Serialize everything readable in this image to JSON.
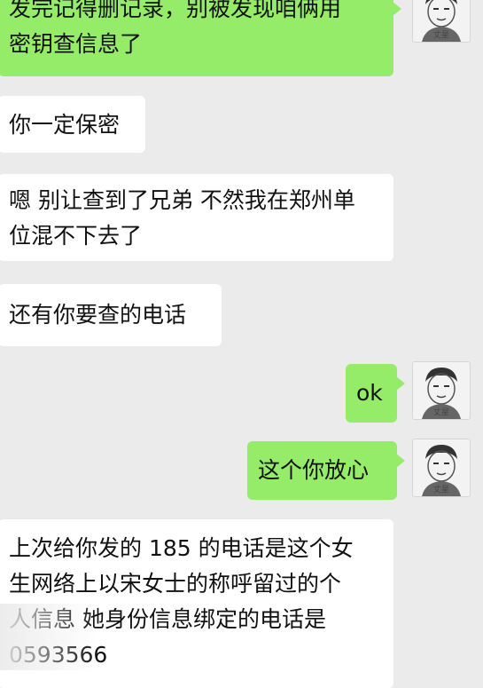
{
  "messages": [
    {
      "side": "out",
      "text": "发完记得删记录，别被发现咱俩用\n密钥查信息了"
    },
    {
      "side": "in",
      "text": "你一定保密"
    },
    {
      "side": "in",
      "text": "嗯 别让查到了兄弟 不然我在郑州单\n位混不下去了"
    },
    {
      "side": "in",
      "text": "还有你要查的电话"
    },
    {
      "side": "out",
      "text": "ok"
    },
    {
      "side": "out",
      "text": "这个你放心"
    },
    {
      "side": "in",
      "text": "上次给你发的 185 的电话是这个女\n生网络上以宋女士的称呼留过的个\n人信息 她身份信息绑定的电话是\n0593566"
    }
  ],
  "avatar": {
    "icon": "person-sketch-icon",
    "caption": "丈星"
  },
  "colors": {
    "background": "#ebebeb",
    "incoming": "#ffffff",
    "outgoing": "#95ec69"
  }
}
